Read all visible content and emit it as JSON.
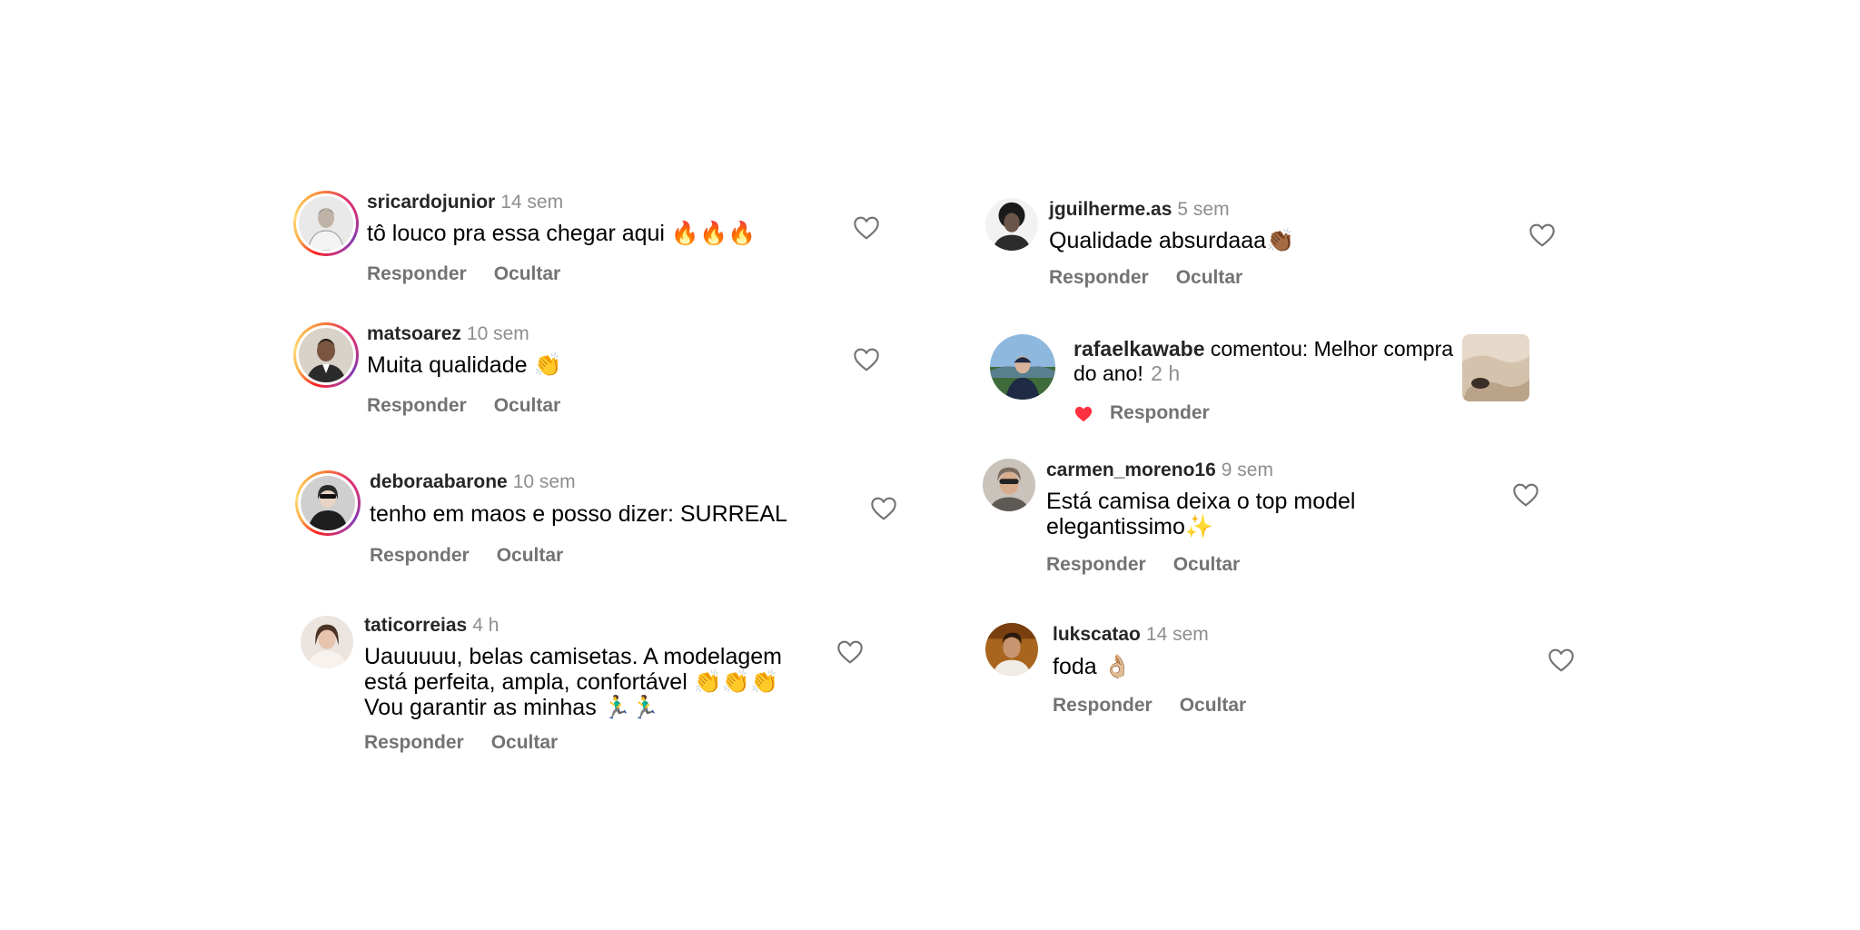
{
  "comments_left": [
    {
      "user": "sricardojunior",
      "time": "14 sem",
      "text": "tô louco pra essa chegar aqui 🔥🔥🔥",
      "reply": "Responder",
      "hide": "Ocultar"
    },
    {
      "user": "matsoarez",
      "time": "10 sem",
      "text": "Muita qualidade 👏",
      "reply": "Responder",
      "hide": "Ocultar"
    },
    {
      "user": "deboraabarone",
      "time": "10 sem",
      "text": "tenho em maos e posso dizer: SURREAL",
      "reply": "Responder",
      "hide": "Ocultar"
    },
    {
      "user": "taticorreias",
      "time": "4 h",
      "text": "Uauuuuu, belas camisetas. A modelagem está perfeita, ampla, confortável 👏👏👏 Vou garantir as minhas 🏃‍♂️🏃‍♂️",
      "reply": "Responder",
      "hide": "Ocultar"
    }
  ],
  "comments_right": [
    {
      "user": "jguilherme.as",
      "time": "5 sem",
      "text": "Qualidade absurdaaa👏🏾",
      "reply": "Responder",
      "hide": "Ocultar"
    },
    {
      "user": "rafaelkawabe",
      "action_text": "comentou: Melhor compra do ano!",
      "time": "2 h",
      "reply": "Responder",
      "liked": true
    },
    {
      "user": "carmen_moreno16",
      "time": "9 sem",
      "text": "Está camisa deixa o top model elegantissimo✨",
      "reply": "Responder",
      "hide": "Ocultar"
    },
    {
      "user": "lukscatao",
      "time": "14 sem",
      "text": "foda 👌🏼",
      "reply": "Responder",
      "hide": "Ocultar"
    }
  ],
  "colors": {
    "story_ring": "#e1306c",
    "liked_heart": "#ff3040",
    "meta": "#737373"
  }
}
